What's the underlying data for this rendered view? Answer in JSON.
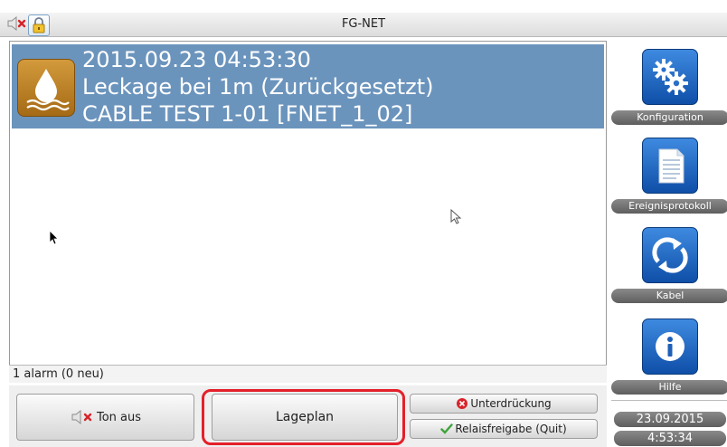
{
  "window": {
    "title": "FG-NET"
  },
  "alarm": {
    "timestamp": "2015.09.23 04:53:30",
    "message": "Leckage bei 1m (Zurückgesetzt)",
    "source": "CABLE TEST 1-01 [FNET_1_02]",
    "icon": "water-leak-icon"
  },
  "status": {
    "text": "1 alarm (0 neu)"
  },
  "buttons": {
    "sound_off": "Ton aus",
    "site_plan": "Lageplan",
    "suppression": "Unterdrückung",
    "relay_release": "Relaisfreigabe (Quit)"
  },
  "sidebar": {
    "items": [
      {
        "label": "Konfiguration",
        "icon": "gears-icon"
      },
      {
        "label": "Ereignisprotokoll",
        "icon": "document-icon"
      },
      {
        "label": "Kabel",
        "icon": "refresh-arrows-icon"
      },
      {
        "label": "Hilfe",
        "icon": "info-icon"
      }
    ]
  },
  "clock": {
    "date": "23.09.2015",
    "time": "4:53:34"
  },
  "colors": {
    "alarm_highlight": "#6b94bd",
    "focus_outline": "#e4202a",
    "icon_blue": "#1f66c2",
    "alarm_icon_orange": "#c48a2e"
  }
}
